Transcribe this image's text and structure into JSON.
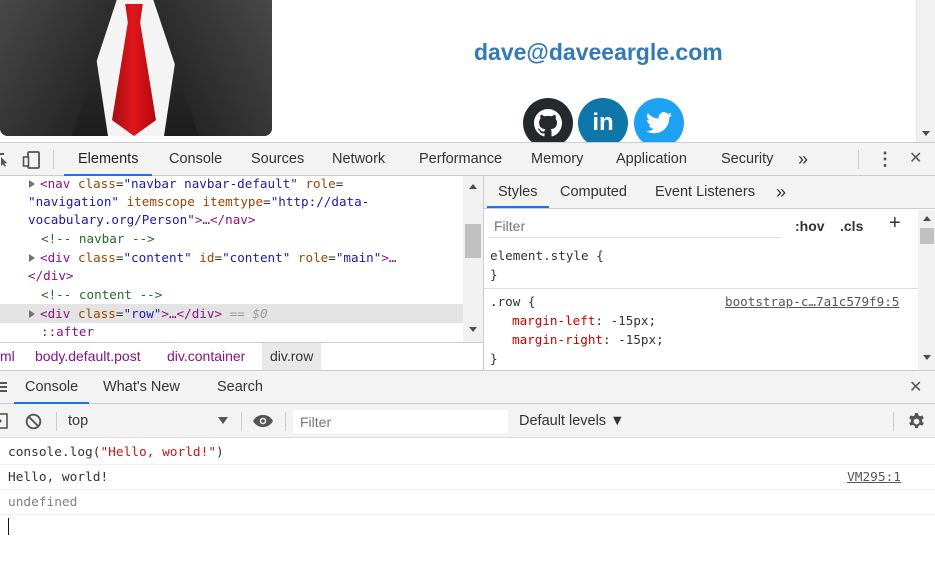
{
  "page": {
    "email": "dave@daveeargle.com",
    "social": [
      "github-icon",
      "linkedin-icon",
      "twitter-icon"
    ],
    "linkedin_glyph": "in"
  },
  "devtools": {
    "tabs": [
      "Elements",
      "Console",
      "Sources",
      "Network",
      "Performance",
      "Memory",
      "Application",
      "Security"
    ],
    "more": "»",
    "menu": "⋮",
    "close": "✕"
  },
  "elements": {
    "lines": {
      "l1_tag_open": "<nav",
      "l1_attr1": "class",
      "l1_val1": "\"navbar navbar-default\"",
      "l1_attr2": "role",
      "l1_eq": "=",
      "l2_val2": "\"navigation\"",
      "l2_attr3": "itemscope",
      "l2_attr4": "itemtype",
      "l2_val4a": "\"http://data-",
      "l3_val4b": "vocabulary.org/Person\"",
      "l3_rest": ">…</nav>",
      "l4_comment": "<!-- navbar -->",
      "l5_tag_open": "<div",
      "l5_attr1": "class",
      "l5_val1": "\"content\"",
      "l5_attr2": "id",
      "l5_val2": "\"content\"",
      "l5_attr3": "role",
      "l5_val3": "\"main\"",
      "l5_rest": ">…",
      "l6_close": "</div>",
      "l7_comment": "<!-- content -->",
      "l8_tag_open": "<div",
      "l8_attr1": "class",
      "l8_val1": "\"row\"",
      "l8_rest": ">…</div>",
      "l8_marker": "== $0",
      "l9_pseudo": "::after"
    },
    "breadcrumbs": [
      "ml",
      "body.default.post",
      "div.container",
      "div.row"
    ]
  },
  "styles": {
    "tabs": [
      "Styles",
      "Computed",
      "Event Listeners"
    ],
    "more": "»",
    "filter_placeholder": "Filter",
    "hov": ":hov",
    "cls": ".cls",
    "plus": "+",
    "element_style_selector": "element.style {",
    "element_style_close": "}",
    "row_selector": ".row",
    "row_open": " {",
    "row_source": "bootstrap-c…7a1c579f9:5",
    "decl1_prop": "margin-left",
    "decl1_val": ": -15px;",
    "decl2_prop": "margin-right",
    "decl2_val": ": -15px;",
    "row_close": "}"
  },
  "drawer": {
    "tabs": [
      "Console",
      "What's New",
      "Search"
    ],
    "close": "✕"
  },
  "console": {
    "context": "top",
    "filter_placeholder": "Filter",
    "levels": "Default levels ▼",
    "input_fn": "console.log(",
    "input_str": "\"Hello, world!\"",
    "input_close": ")",
    "output": "Hello, world!",
    "output_source": "VM295:1",
    "result": "undefined"
  }
}
